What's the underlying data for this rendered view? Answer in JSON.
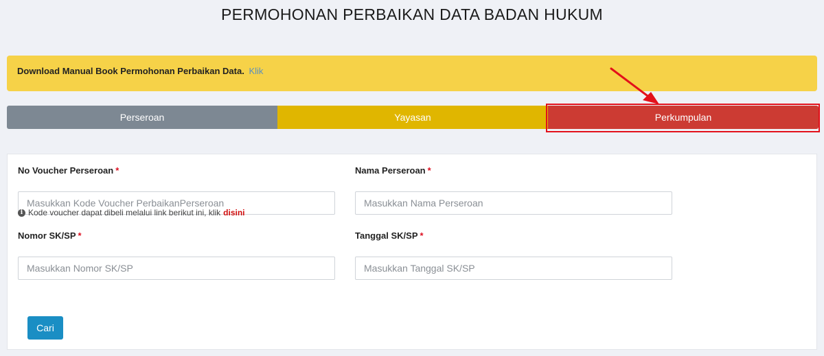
{
  "page": {
    "title": "PERMOHONAN PERBAIKAN DATA BADAN HUKUM"
  },
  "banner": {
    "text": "Download Manual Book Permohonan Perbaikan Data.",
    "link": "Klik"
  },
  "tabs": [
    {
      "label": "Perseroan",
      "color": "#7d8893"
    },
    {
      "label": "Yayasan",
      "color": "#e0b600"
    },
    {
      "label": "Perkumpulan",
      "color": "#cc3b33",
      "highlighted": true
    }
  ],
  "form": {
    "voucher": {
      "label": "No Voucher Perseroan",
      "required_mark": "*",
      "placeholder": "Masukkan Kode Voucher PerbaikanPerseroan",
      "value": ""
    },
    "hint": {
      "text": "Kode voucher dapat dibeli melalui link berikut ini, klik",
      "link": "disini"
    },
    "nama": {
      "label": "Nama Perseroan",
      "required_mark": "*",
      "placeholder": "Masukkan Nama Perseroan",
      "value": ""
    },
    "nomor_sk": {
      "label": "Nomor SK/SP",
      "required_mark": "*",
      "placeholder": "Masukkan Nomor SK/SP",
      "value": ""
    },
    "tanggal_sk": {
      "label": "Tanggal SK/SP",
      "required_mark": "*",
      "placeholder": "Masukkan Tanggal SK/SP",
      "value": ""
    },
    "submit_label": "Cari"
  },
  "annotation": {
    "arrow_color": "#e3101a",
    "box_color": "#e3101a"
  }
}
